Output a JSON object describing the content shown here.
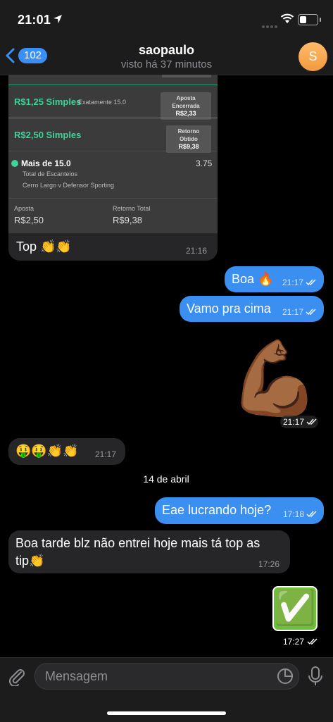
{
  "status": {
    "time": "21:01"
  },
  "header": {
    "back_count": "102",
    "title": "saopaulo",
    "subtitle": "visto há 37 minutos",
    "avatar_letter": "S"
  },
  "card": {
    "row1_label": "R$1,25 Simples",
    "row1_sub": "Exatamente 15.0",
    "row1_pill_title": "Aposta Encerrada",
    "row1_pill_value": "R$2,33",
    "row2_label": "R$2,50 Simples",
    "row2_pill_title": "Retorno Obtido",
    "row2_pill_value": "R$9,38",
    "bet_title": "Mais de 15.0",
    "bet_odds": "3.75",
    "bet_market": "Total de Escanteios",
    "bet_match": "Cerro Largo v Defensor Sporting",
    "stake_label": "Aposta",
    "stake_value": "R$2,50",
    "return_label": "Retorno Total",
    "return_value": "R$9,38"
  },
  "messages": [
    {
      "text": "Top 👏👏",
      "time": "21:16"
    },
    {
      "text": "Boa 🔥",
      "time": "21:17"
    },
    {
      "text": "Vamo pra cima",
      "time": "21:17"
    },
    {
      "text": "💪🏾",
      "time": "21:17"
    },
    {
      "text": "🤑🤑👏👏",
      "time": "21:17"
    },
    {
      "text": "Eae lucrando hoje?",
      "time": "17:18"
    },
    {
      "text_line1": "Boa tarde blz não entrei hoje mais tá top as",
      "text_line2": "tip👏",
      "time": "17:26"
    },
    {
      "text": "✅",
      "time": "17:27"
    }
  ],
  "date_separator": "14 de abril",
  "input": {
    "placeholder": "Mensagem"
  },
  "colors": {
    "outgoing": "#3b8ff0",
    "incoming": "#262628",
    "accent_green": "#3fd29a",
    "badge": "#3a8ff7"
  }
}
